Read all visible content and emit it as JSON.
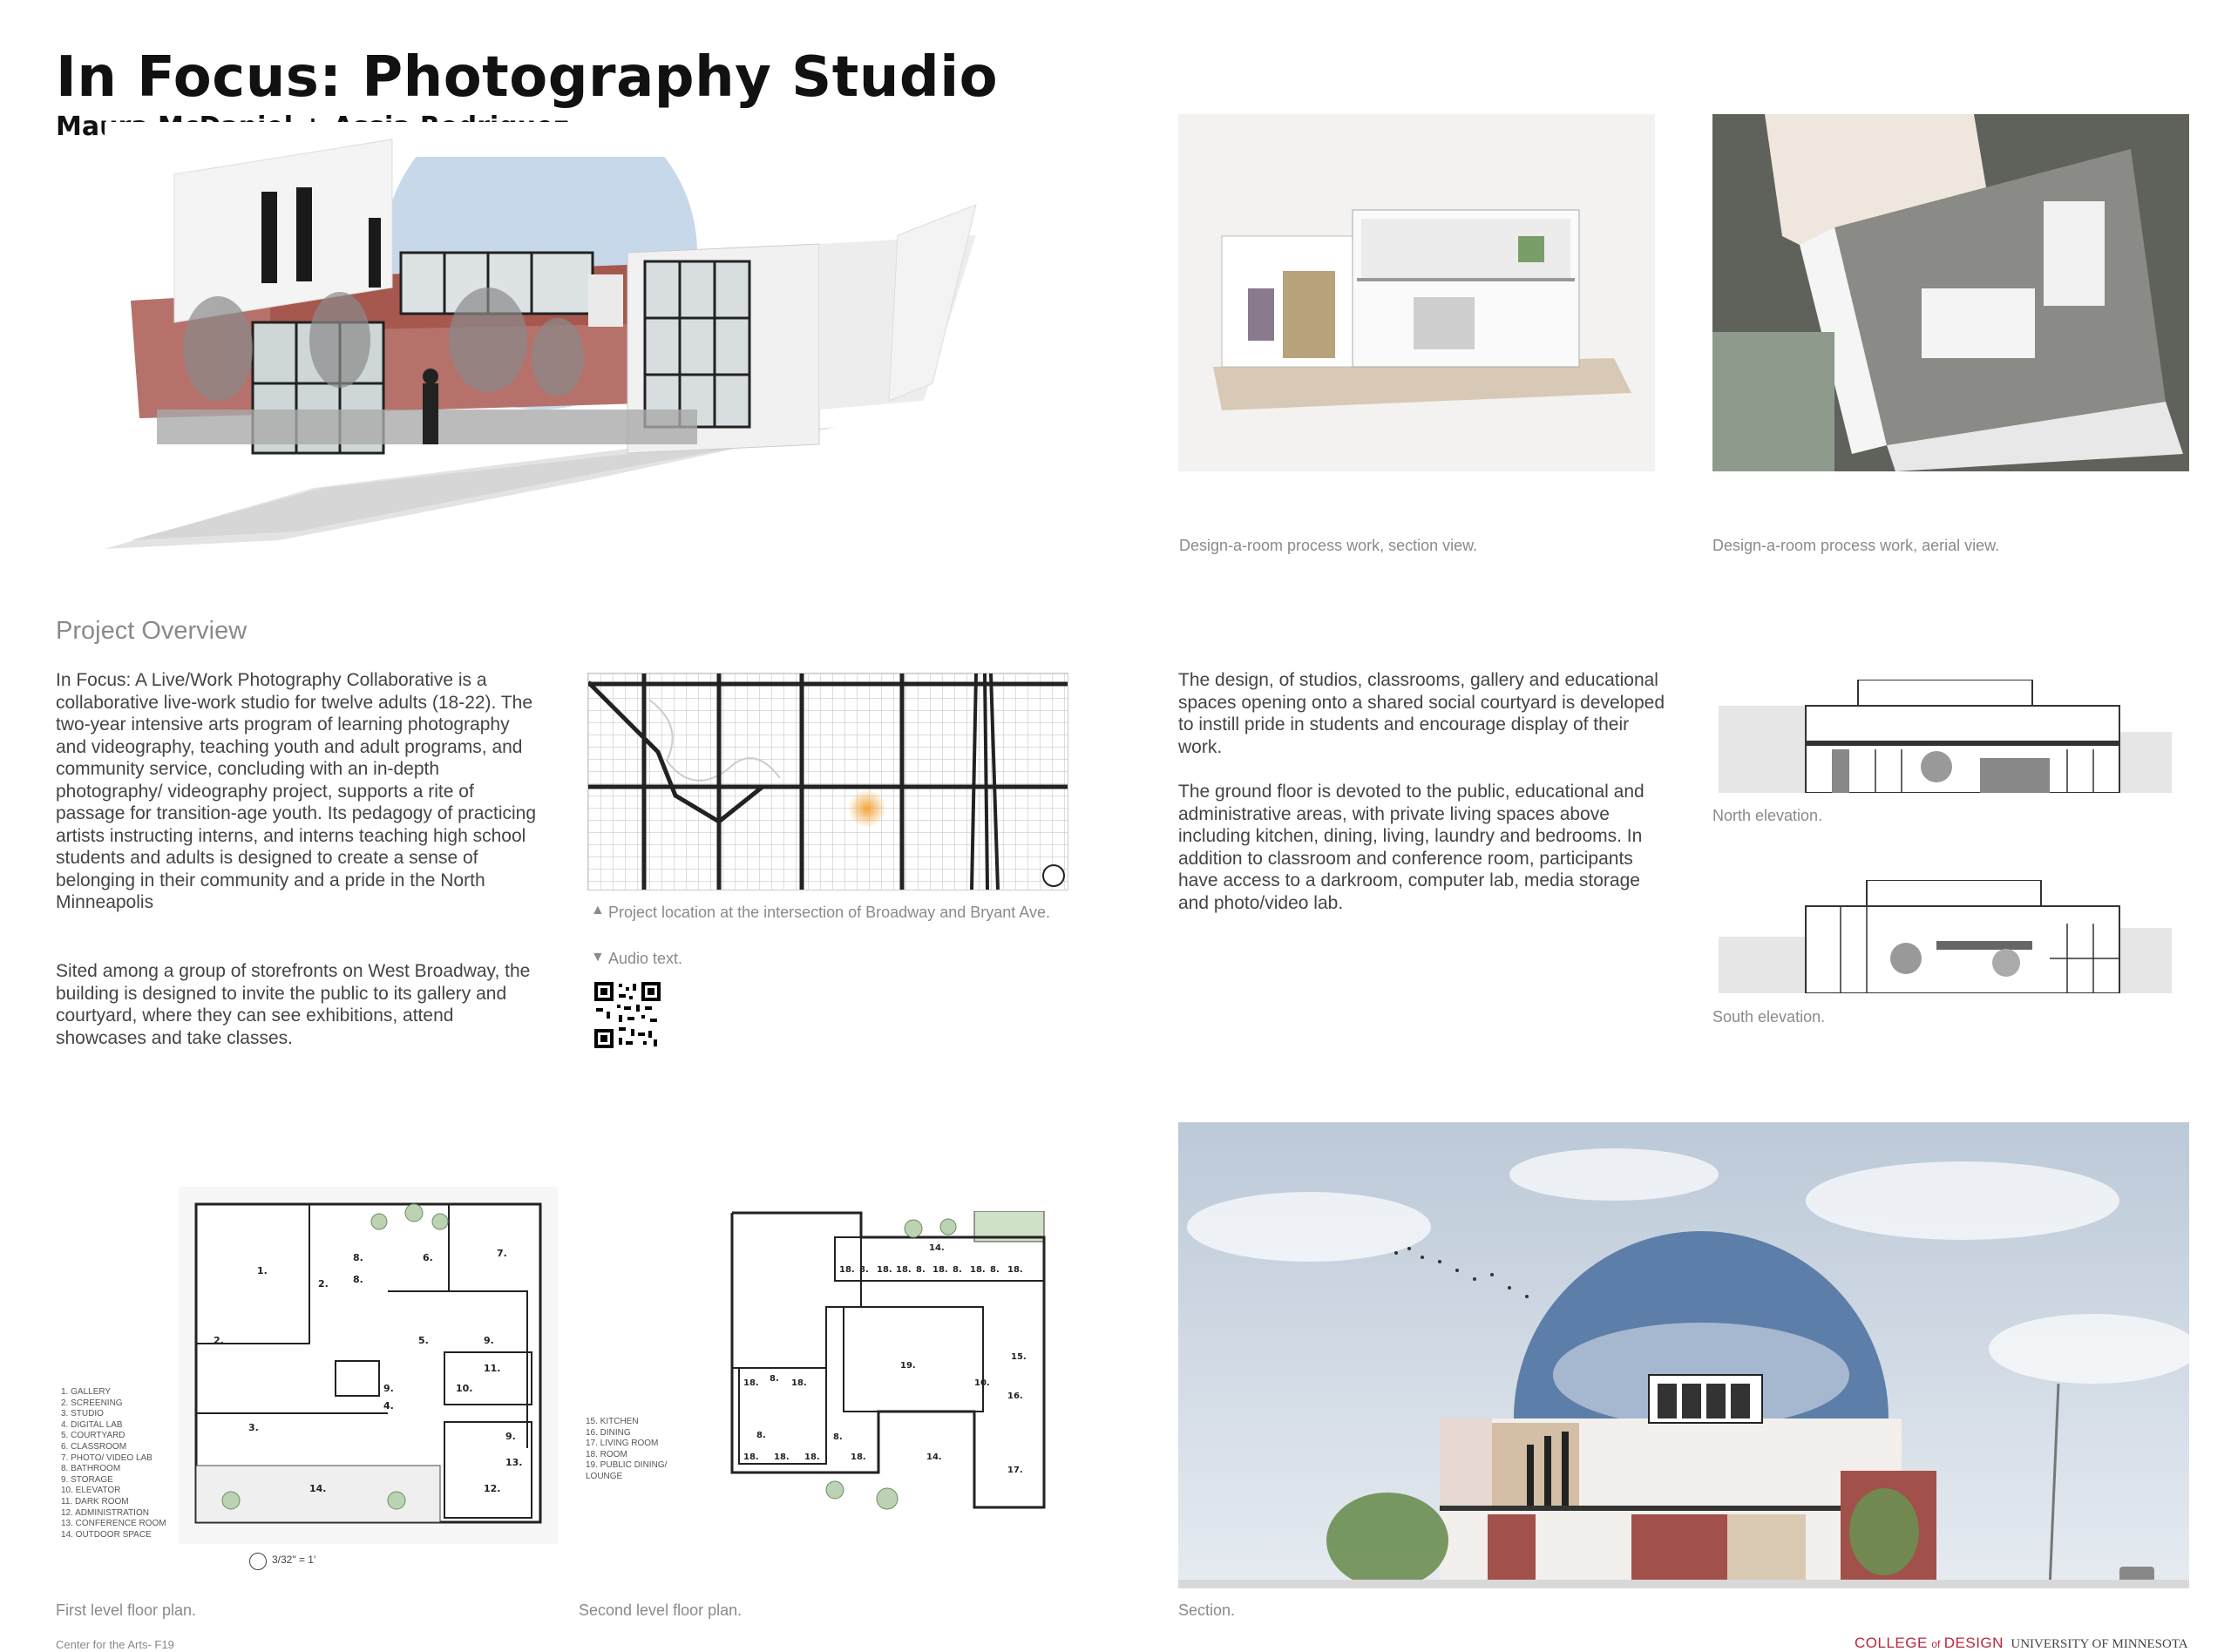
{
  "title": "In Focus: Photography Studio",
  "authors": "Maura McDaniel + Assia Rodriguez",
  "captions": {
    "section_view": "Design-a-room process work, section view.",
    "aerial_view": "Design-a-room process work, aerial view.",
    "north_elevation": "North elevation.",
    "south_elevation": "South elevation.",
    "first_floor": "First level floor plan.",
    "second_floor": "Second level floor plan.",
    "section": "Section.",
    "map": "Project location at the intersection of Broadway and Bryant Ave.",
    "audio": "Audio text."
  },
  "overview": {
    "heading": "Project Overview",
    "paragraph1": "In Focus: A Live/Work Photography Collaborative is a collaborative live-work studio for twelve adults (18-22). The two-year intensive arts program of learning photography and videography, teaching youth and adult programs, and community service, concluding with an in-depth photography/ videography project, supports a rite of passage for transition-age youth. Its pedagogy of practicing artists instructing interns, and interns teaching high school students and adults is designed to create a sense of belonging in their community and a pride in the North Minneapolis",
    "paragraph2": "Sited among a group of storefronts on West Broadway, the building is designed to invite the public to its gallery and courtyard, where they can see exhibitions, attend showcases and take classes.",
    "paragraph3": "The design, of studios, classrooms, gallery and educational spaces opening onto a shared social courtyard is developed to instill pride in students and encourage display of their work.",
    "paragraph4": "The ground floor is devoted to the public, educational and administrative areas, with private living spaces above including kitchen, dining, living, laundry and bedrooms. In addition to classroom and conference room, participants have access to a darkroom, computer lab, media storage and photo/video lab."
  },
  "legend_first": [
    "1.   GALLERY",
    "2.   SCREENING",
    "3.   STUDIO",
    "4.   DIGITAL LAB",
    "5.   COURTYARD",
    "6.   CLASSROOM",
    "7.   PHOTO/ VIDEO LAB",
    "8.   BATHROOM",
    "9.   STORAGE",
    "10. ELEVATOR",
    "11. DARK ROOM",
    "12. ADMINISTRATION",
    "13. CONFERENCE ROOM",
    "14. OUTDOOR SPACE"
  ],
  "legend_second": [
    "15. KITCHEN",
    "16. DINING",
    "17. LIVING ROOM",
    "18. ROOM",
    "19. PUBLIC DINING/",
    "LOUNGE"
  ],
  "scale": "3/32\" = 1'",
  "first_plan_labels": [
    "1.",
    "2.",
    "2.",
    "3.",
    "4.",
    "5.",
    "6.",
    "7.",
    "8.",
    "8.",
    "9.",
    "9.",
    "9.",
    "10.",
    "11.",
    "12.",
    "13.",
    "14."
  ],
  "second_plan_labels": [
    "14.",
    "18.",
    "8.",
    "18.",
    "18.",
    "8.",
    "18.",
    "8.",
    "18.",
    "8.",
    "18.",
    "15.",
    "18.",
    "8.",
    "18.",
    "19.",
    "10.",
    "16.",
    "18.",
    "18.",
    "8.",
    "18.",
    "8.",
    "18.",
    "14.",
    "17."
  ],
  "footer_left": "Center for the Arts- F19",
  "footer_brand": {
    "college": "COLLEGE",
    "of": "of",
    "design": "DESIGN",
    "university": "UNIVERSITY OF MINNESOTA"
  },
  "colors": {
    "brand_red": "#b8283a",
    "sky_blue": "#c5d7ea",
    "brick": "#a8574e",
    "map_dot": "#f0a53a"
  }
}
